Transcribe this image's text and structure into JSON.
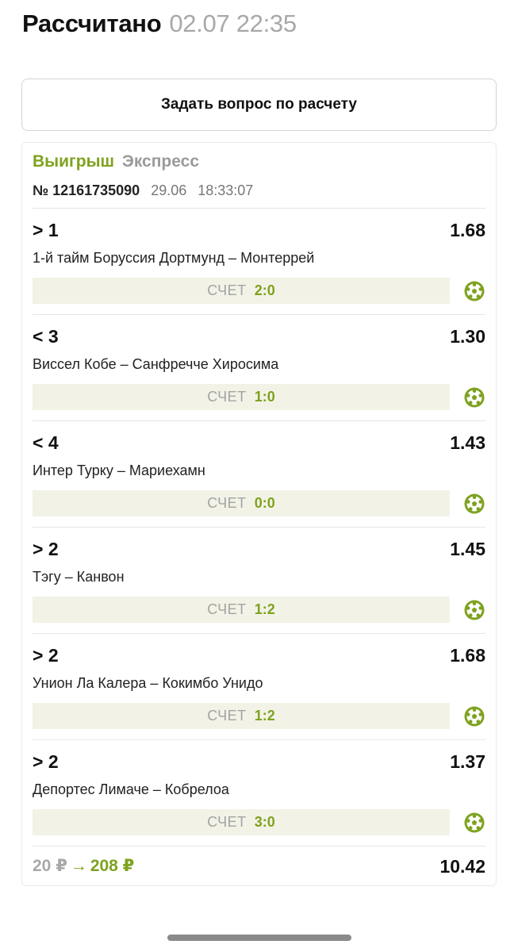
{
  "header": {
    "status": "Рассчитано",
    "datetime": "02.07 22:35"
  },
  "ask_button": {
    "label": "Задать вопрос по расчету"
  },
  "bet": {
    "result": "Выигрыш",
    "type": "Экспресс",
    "number": "№ 12161735090",
    "date": "29.06",
    "time": "18:33:07",
    "score_label": "СЧЕТ",
    "legs": [
      {
        "condition": "> 1",
        "odds": "1.68",
        "match": "1-й тайм Боруссия Дортмунд – Монтеррей",
        "score": "2:0"
      },
      {
        "condition": "< 3",
        "odds": "1.30",
        "match": "Виссел Кобе – Санфречче Хиросима",
        "score": "1:0"
      },
      {
        "condition": "< 4",
        "odds": "1.43",
        "match": "Интер Турку – Мариехамн",
        "score": "0:0"
      },
      {
        "condition": "> 2",
        "odds": "1.45",
        "match": "Тэгу – Канвон",
        "score": "1:2"
      },
      {
        "condition": "> 2",
        "odds": "1.68",
        "match": "Унион Ла Калера – Кокимбо Унидо",
        "score": "1:2"
      },
      {
        "condition": "> 2",
        "odds": "1.37",
        "match": "Депортес Лимаче – Кобрелоа",
        "score": "3:0"
      }
    ],
    "stake": "20 ₽",
    "arrow": "→",
    "payout": "208 ₽",
    "total_odds": "10.42"
  },
  "icons": {
    "leg_status": "soccer-ball-icon",
    "accent_color": "#7ea21f"
  }
}
